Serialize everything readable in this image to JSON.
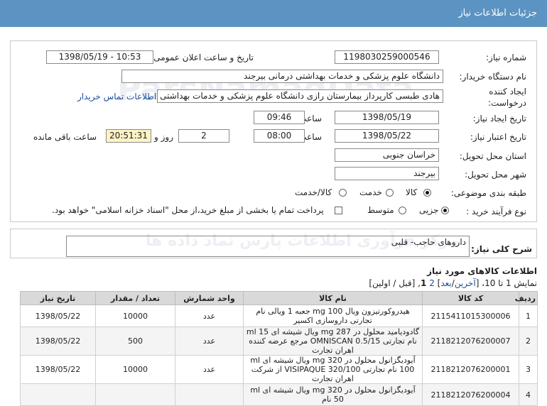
{
  "header": {
    "title": "جزئیات اطلاعات نیاز"
  },
  "form": {
    "need_number_label": "شماره نیاز:",
    "need_number": "1198030259000546",
    "announce_label": "تاریخ و ساعت اعلان عمومی:",
    "announce_value": "1398/05/19 - 10:53",
    "buyer_label": "نام دستگاه خریدار:",
    "buyer_value": "دانشگاه علوم پزشکی و خدمات بهداشتی درمانی بیرجند",
    "creator_label_1": "ایجاد کننده",
    "creator_label_2": "درخواست:",
    "creator_value": "هادی طبسی کارپرداز بیمارستان رازی دانشگاه علوم پزشکی و خدمات بهداشتی درمانی بیرجند",
    "contact_link": "اطلاعات تماس خریدار",
    "created_date_label": "تاریخ ایجاد نیاز:",
    "created_date": "1398/05/19",
    "time_label": "ساعت",
    "created_time": "09:46",
    "validity_label": "تاریخ اعتبار نیاز:",
    "validity_date": "1398/05/22",
    "validity_time": "08:00",
    "days_label": "روز و",
    "days_value": "2",
    "remaining_time": "20:51:31",
    "remaining_label": "ساعت باقی مانده",
    "province_label": "استان محل تحویل:",
    "province_value": "خراسان جنوبی",
    "city_label": "شهر محل تحویل:",
    "city_value": "بیرجند",
    "category_label": "طبقه بندی موضوعی:",
    "category_options": [
      "کالا",
      "خدمت",
      "کالا/خدمت"
    ],
    "process_label": "نوع فرآیند خرید :",
    "process_options": [
      "جزیی",
      "متوسط"
    ],
    "payment_note": "پرداخت تمام یا بخشی از مبلغ خرید،از محل \"اسناد خزانه اسلامی\" خواهد بود."
  },
  "description": {
    "label": "شرح کلی نیاز:",
    "value": "داروهای حاجب- قلبی"
  },
  "items_section": {
    "title": "اطلاعات کالاهای مورد نیاز",
    "pager_prefix": "نمایش 1 تا 10،  [",
    "pager_last": "آخرین",
    "pager_slash": "/",
    "pager_next": "بعد",
    "pager_close": "]",
    "pager_page2": "2",
    "pager_page1": "1",
    "pager_tail": "[قبل / اولین]",
    "columns": [
      "ردیف",
      "کد کالا",
      "نام کالا",
      "واحد شمارش",
      "تعداد / مقدار",
      "تاریخ نیاز"
    ],
    "rows": [
      {
        "row": "1",
        "code": "2115411015300006",
        "name": "هیدروکورتیزون ویال mg 100 جعبه 1 ویالی نام تجارتی داروسازی اکسیر",
        "unit": "عدد",
        "qty": "10000",
        "date": "1398/05/22"
      },
      {
        "row": "2",
        "code": "2118212076200007",
        "name": "گادودیامید محلول در mg 287 ویال شیشه ای ml 15 نام تجارتی OMNISCAN 0.5/15 مرجع عرضه کننده اهران تجارت",
        "unit": "عدد",
        "qty": "500",
        "date": "1398/05/22"
      },
      {
        "row": "3",
        "code": "2118212076200001",
        "name": "آیوديگزانول محلول در mg 320 ویال شیشه ای ml 100 نام تجارتی VISIPAQUE 320/100 از شرکت اهران تجارت",
        "unit": "عدد",
        "qty": "10000",
        "date": "1398/05/22"
      },
      {
        "row": "4",
        "code": "2118212076200004",
        "name": "آیوديگزانول محلول در mg 320 ویال شیشه ای ml 50 نام",
        "unit": "",
        "qty": "",
        "date": ""
      }
    ]
  }
}
